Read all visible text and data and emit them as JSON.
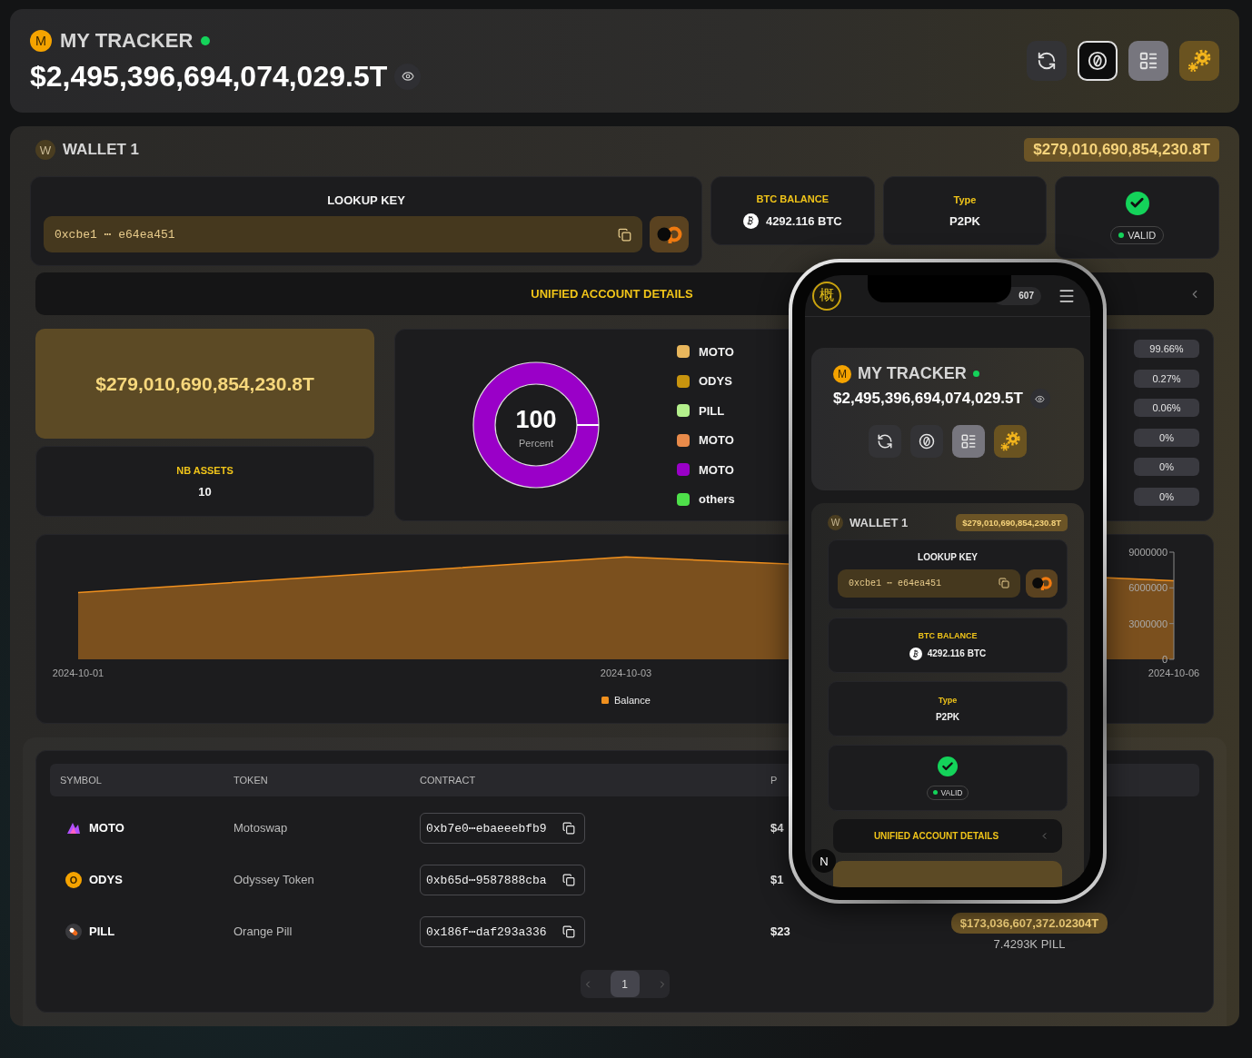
{
  "header": {
    "avatar": "M",
    "title": "MY TRACKER",
    "online": true,
    "total": "$2,495,396,694,074,029.5T",
    "toolbar": [
      {
        "kind": "refresh",
        "selected": false,
        "focused": false
      },
      {
        "kind": "zero",
        "selected": false,
        "focused": true
      },
      {
        "kind": "list",
        "selected": true,
        "focused": false
      },
      {
        "kind": "settings",
        "selected": false,
        "focused": false
      }
    ]
  },
  "wallet": {
    "avatar": "W",
    "name": "WALLET 1",
    "total": "$279,010,690,854,230.8T",
    "lookup": {
      "label": "LOOKUP KEY",
      "value": "0xcbe1 ⋯ e64ea451"
    },
    "btc": {
      "label": "BTC BALANCE",
      "value": "4292.116 BTC"
    },
    "type": {
      "label": "Type",
      "value": "P2PK"
    },
    "status": {
      "valid": true,
      "label": "VALID"
    },
    "unified": {
      "label": "UNIFIED ACCOUNT DETAILS"
    },
    "summary": {
      "total": "$279,010,690,854,230.8T",
      "assets_label": "NB ASSETS",
      "assets": "10"
    },
    "allocation": {
      "center_value": "100",
      "center_label": "Percent",
      "items": [
        {
          "symbol": "MOTO",
          "color": "#e8b65c",
          "share": "99.66%"
        },
        {
          "symbol": "ODYS",
          "color": "#c8940e",
          "share": "0.27%"
        },
        {
          "symbol": "PILL",
          "color": "#b4f08c",
          "share": "0.06%"
        },
        {
          "symbol": "MOTO",
          "color": "#e88a4a",
          "share": "0%"
        },
        {
          "symbol": "MOTO",
          "color": "#9a00c8",
          "share": "0%"
        },
        {
          "symbol": "others",
          "color": "#4ee04a",
          "share": "0%"
        }
      ]
    },
    "chart": {
      "chart_data": {
        "type": "area",
        "categories": [
          "2024-10-01",
          "2024-10-03",
          "2024-10-06"
        ],
        "ylim": [
          0,
          9000000
        ],
        "yticks": [
          0,
          3000000,
          6000000,
          9000000
        ],
        "series": [
          {
            "name": "Balance",
            "color": "#f0901e",
            "values": [
              5600000,
              8600000,
              6600000
            ]
          }
        ]
      }
    },
    "table": {
      "columns": [
        "SYMBOL",
        "TOKEN",
        "CONTRACT",
        "P"
      ],
      "rows": [
        {
          "kind": "moto",
          "symbol": "MOTO",
          "token": "Motoswap",
          "contract": "0xb7e0⋯ebaeeebfb9",
          "price": "$4"
        },
        {
          "kind": "odys",
          "logo_letter": "O",
          "symbol": "ODYS",
          "token": "Odyssey Token",
          "contract": "0xb65d⋯9587888cba",
          "price": "$1"
        },
        {
          "kind": "pill",
          "symbol": "PILL",
          "token": "Orange Pill",
          "contract": "0x186f⋯daf293a336",
          "price": "$23",
          "column_5": {
            "value": "$173,036,607,372.02304T",
            "amount": "7.4293K PILL"
          }
        }
      ]
    },
    "pagination": {
      "pages": [
        {
          "label": "1",
          "selected": true
        }
      ]
    }
  },
  "phone": {
    "logo": "概",
    "counter": "607",
    "badge": "N",
    "header": {
      "avatar": "M",
      "title": "MY TRACKER",
      "online": true,
      "total": "$2,495,396,694,074,029.5T",
      "toolbar": [
        {
          "kind": "refresh",
          "selected": false
        },
        {
          "kind": "zero",
          "selected": false
        },
        {
          "kind": "list",
          "selected": true
        },
        {
          "kind": "settings",
          "selected": false
        }
      ]
    },
    "wallet": {
      "avatar": "W",
      "name": "WALLET 1",
      "total": "$279,010,690,854,230.8T",
      "lookup_label": "LOOKUP KEY",
      "lookup_value": "0xcbe1 ⋯ e64ea451",
      "btc_label": "BTC BALANCE",
      "btc_value": "4292.116 BTC",
      "type_label": "Type",
      "type_value": "P2PK",
      "valid": true,
      "status_label": "VALID",
      "unified_label": "UNIFIED ACCOUNT DETAILS"
    }
  }
}
